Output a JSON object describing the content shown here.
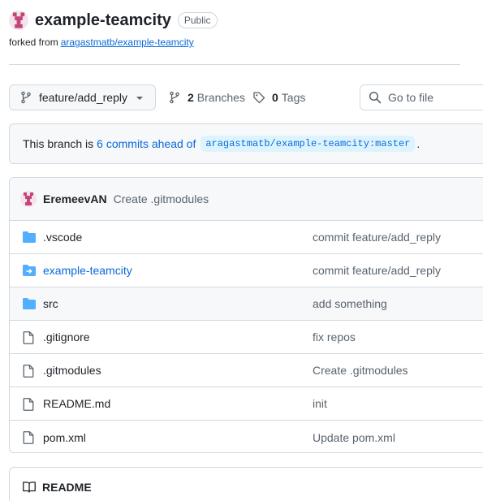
{
  "repo": {
    "name": "example-teamcity",
    "visibility": "Public",
    "forked_prefix": "forked from",
    "forked_from": "aragastmatb/example-teamcity"
  },
  "toolbar": {
    "branch": "feature/add_reply",
    "branches_count": "2",
    "branches_label": "Branches",
    "tags_count": "0",
    "tags_label": "Tags",
    "goto_placeholder": "Go to file"
  },
  "ahead_banner": {
    "prefix": "This branch is",
    "link": "6 commits ahead of",
    "ref": "aragastmatb/example-teamcity:master",
    "suffix": "."
  },
  "latest_commit": {
    "author": "EremeevAN",
    "message": "Create .gitmodules"
  },
  "files": [
    {
      "name": ".vscode",
      "type": "folder",
      "message": "commit feature/add_reply"
    },
    {
      "name": "example-teamcity",
      "type": "submodule",
      "message": "commit feature/add_reply"
    },
    {
      "name": "src",
      "type": "folder",
      "message": "add something"
    },
    {
      "name": ".gitignore",
      "type": "file",
      "message": "fix repos"
    },
    {
      "name": ".gitmodules",
      "type": "file",
      "message": "Create .gitmodules"
    },
    {
      "name": "README.md",
      "type": "file",
      "message": "init"
    },
    {
      "name": "pom.xml",
      "type": "file",
      "message": "Update pom.xml"
    }
  ],
  "readme": {
    "title": "README"
  },
  "colors": {
    "link": "#0969da",
    "folder": "#54aeff",
    "muted": "#59636e",
    "border": "#d1d9e0"
  }
}
